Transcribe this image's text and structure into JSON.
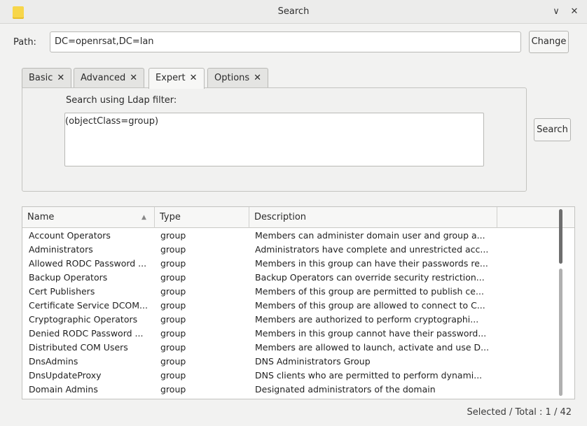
{
  "window": {
    "title": "Search",
    "minimize_glyph": "∨",
    "close_glyph": "✕"
  },
  "path": {
    "label": "Path:",
    "value": "DC=openrsat,DC=lan",
    "change_label": "Change"
  },
  "tabs": [
    {
      "label": "Basic",
      "close": "✕"
    },
    {
      "label": "Advanced",
      "close": "✕"
    },
    {
      "label": "Expert",
      "close": "✕"
    },
    {
      "label": "Options",
      "close": "✕"
    }
  ],
  "expert": {
    "filter_label": "Search using Ldap filter:",
    "filter_value": "(objectClass=group)"
  },
  "search_label": "Search",
  "table": {
    "headers": {
      "name": "Name",
      "type": "Type",
      "description": "Description"
    },
    "sort_indicator": "▲",
    "rows": [
      {
        "name": "Account Operators",
        "type": "group",
        "description": "Members can administer domain user and group a..."
      },
      {
        "name": "Administrators",
        "type": "group",
        "description": "Administrators have complete and unrestricted acc..."
      },
      {
        "name": "Allowed RODC Password ...",
        "type": "group",
        "description": "Members in this group can have their passwords re..."
      },
      {
        "name": "Backup Operators",
        "type": "group",
        "description": "Backup Operators can override security restriction..."
      },
      {
        "name": "Cert Publishers",
        "type": "group",
        "description": "Members of this group are permitted to publish ce..."
      },
      {
        "name": "Certificate Service DCOM...",
        "type": "group",
        "description": "Members of this group are allowed to connect to C..."
      },
      {
        "name": "Cryptographic Operators",
        "type": "group",
        "description": "Members are authorized to perform cryptographi..."
      },
      {
        "name": "Denied RODC Password ...",
        "type": "group",
        "description": "Members in this group cannot have their password..."
      },
      {
        "name": "Distributed COM Users",
        "type": "group",
        "description": "Members are allowed to launch, activate and use D..."
      },
      {
        "name": "DnsAdmins",
        "type": "group",
        "description": "DNS Administrators Group"
      },
      {
        "name": "DnsUpdateProxy",
        "type": "group",
        "description": "DNS clients who are permitted to perform dynami..."
      },
      {
        "name": "Domain Admins",
        "type": "group",
        "description": "Designated administrators of the domain"
      }
    ]
  },
  "status": {
    "text": "Selected / Total : 1 / 42"
  }
}
